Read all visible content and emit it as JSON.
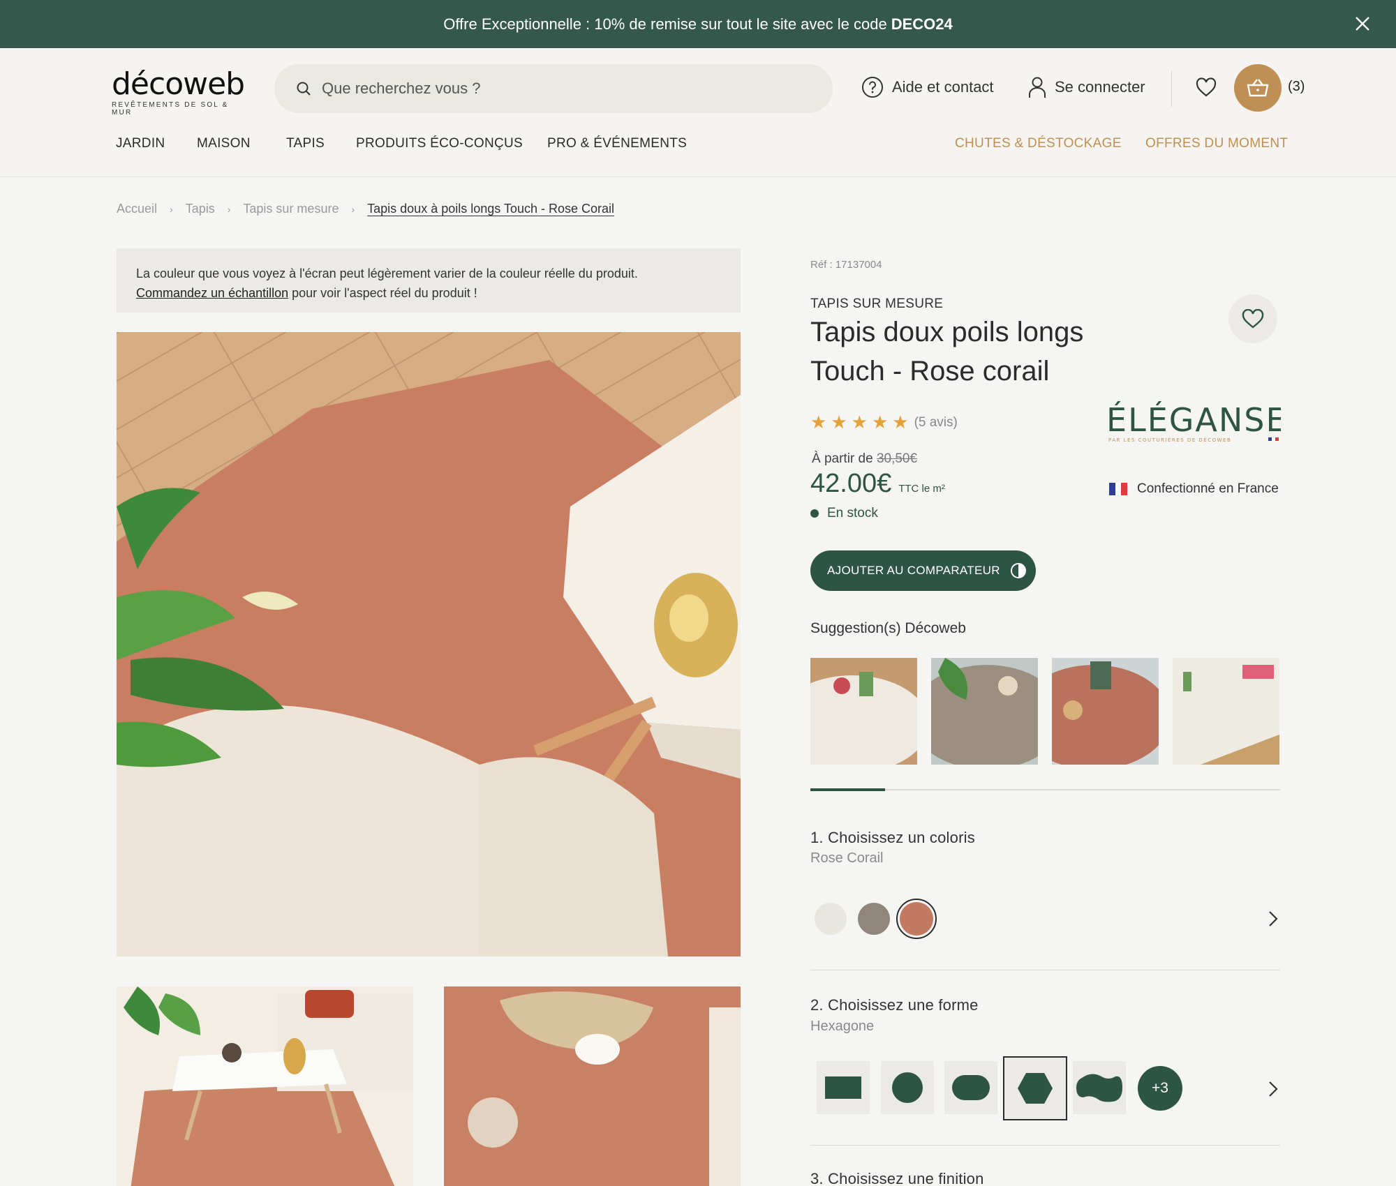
{
  "promo": {
    "text": "Offre Exceptionnelle : 10% de remise sur tout le site avec le code",
    "code": "DECO24",
    "close_icon": "close-icon"
  },
  "header": {
    "logo_word": "décoweb",
    "logo_sub": "REVÊTEMENTS DE SOL & MUR",
    "search_placeholder": "Que recherchez vous ?",
    "help_label": "Aide et contact",
    "login_label": "Se connecter",
    "cart_count": "(3)",
    "nav": [
      "JARDIN",
      "MAISON",
      "TAPIS",
      "PRODUITS ÉCO-CONÇUS",
      "PRO & ÉVÉNEMENTS"
    ],
    "nav_right": [
      "CHUTES & DÉSTOCKAGE",
      "OFFRES DU MOMENT"
    ]
  },
  "breadcrumb": [
    "Accueil",
    "Tapis",
    "Tapis sur mesure",
    "Tapis doux à poils longs Touch - Rose Corail"
  ],
  "notice": {
    "line1": "La couleur que vous voyez à l'écran peut légèrement varier de la couleur réelle du produit.",
    "link": "Commandez un échantillon",
    "line2": " pour voir l'aspect réel du produit !"
  },
  "product": {
    "ref": "Réf : 17137004",
    "category": "TAPIS SUR MESURE",
    "title": "Tapis doux poils longs Touch - Rose corail",
    "rating": 5,
    "reviews": "(5 avis)",
    "brand": "ÉLÉGANSE",
    "brand_sub": "PAR LES COUTURIÈRES DE DÉCOWEB",
    "price_from_label": "À partir de",
    "price_old": "30,50€",
    "price": "42.00€",
    "price_unit": "TTC le m²",
    "made_in": "Confectionné en France",
    "stock": "En stock",
    "compare_label": "AJOUTER AU COMPARATEUR",
    "suggestions_title": "Suggestion(s) Décoweb"
  },
  "options": {
    "step1_title": "1. Choisissez un coloris",
    "step1_value": "Rose Corail",
    "colors": [
      "#e8e6df",
      "#8f877c",
      "#c27a62"
    ],
    "step2_title": "2. Choisissez une forme",
    "step2_value": "Hexagone",
    "shapes": [
      "rectangle",
      "round",
      "oval",
      "hexagon",
      "organic"
    ],
    "more_label": "+3",
    "step3_title": "3. Choisissez une finition"
  },
  "colors": {
    "green": "#2e5445",
    "promo_green": "#34584b",
    "gold": "#bf8f53",
    "star": "#e4a23a"
  }
}
